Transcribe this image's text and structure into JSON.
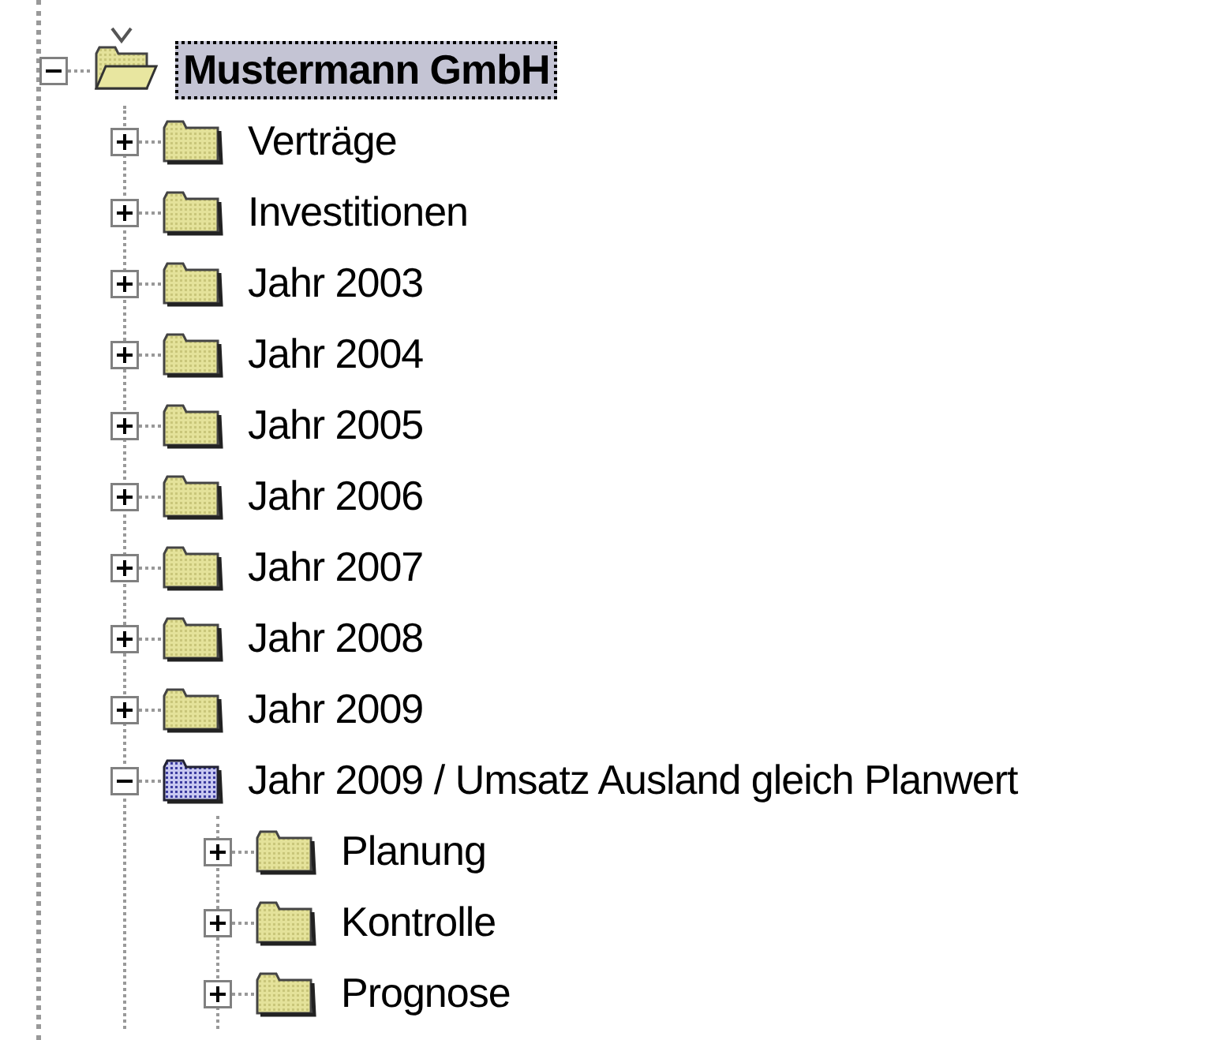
{
  "tree": [
    {
      "label": "Mustermann GmbH",
      "kind": "open-folder",
      "expanded": true,
      "selected": true,
      "children": [
        {
          "label": "Verträge",
          "kind": "folder",
          "expanded": false,
          "selected": false
        },
        {
          "label": "Investitionen",
          "kind": "folder",
          "expanded": false,
          "selected": false
        },
        {
          "label": "Jahr 2003",
          "kind": "folder",
          "expanded": false,
          "selected": false
        },
        {
          "label": "Jahr 2004",
          "kind": "folder",
          "expanded": false,
          "selected": false
        },
        {
          "label": "Jahr 2005",
          "kind": "folder",
          "expanded": false,
          "selected": false
        },
        {
          "label": "Jahr 2006",
          "kind": "folder",
          "expanded": false,
          "selected": false
        },
        {
          "label": "Jahr 2007",
          "kind": "folder",
          "expanded": false,
          "selected": false
        },
        {
          "label": "Jahr 2008",
          "kind": "folder",
          "expanded": false,
          "selected": false
        },
        {
          "label": "Jahr 2009",
          "kind": "folder",
          "expanded": false,
          "selected": false
        },
        {
          "label": "Jahr 2009 / Umsatz Ausland gleich Planwert",
          "kind": "checkered-folder",
          "expanded": true,
          "selected": false,
          "children": [
            {
              "label": "Planung",
              "kind": "folder",
              "expanded": false,
              "selected": false
            },
            {
              "label": "Kontrolle",
              "kind": "folder",
              "expanded": false,
              "selected": false
            },
            {
              "label": "Prognose",
              "kind": "folder",
              "expanded": false,
              "selected": false
            }
          ]
        }
      ]
    }
  ]
}
